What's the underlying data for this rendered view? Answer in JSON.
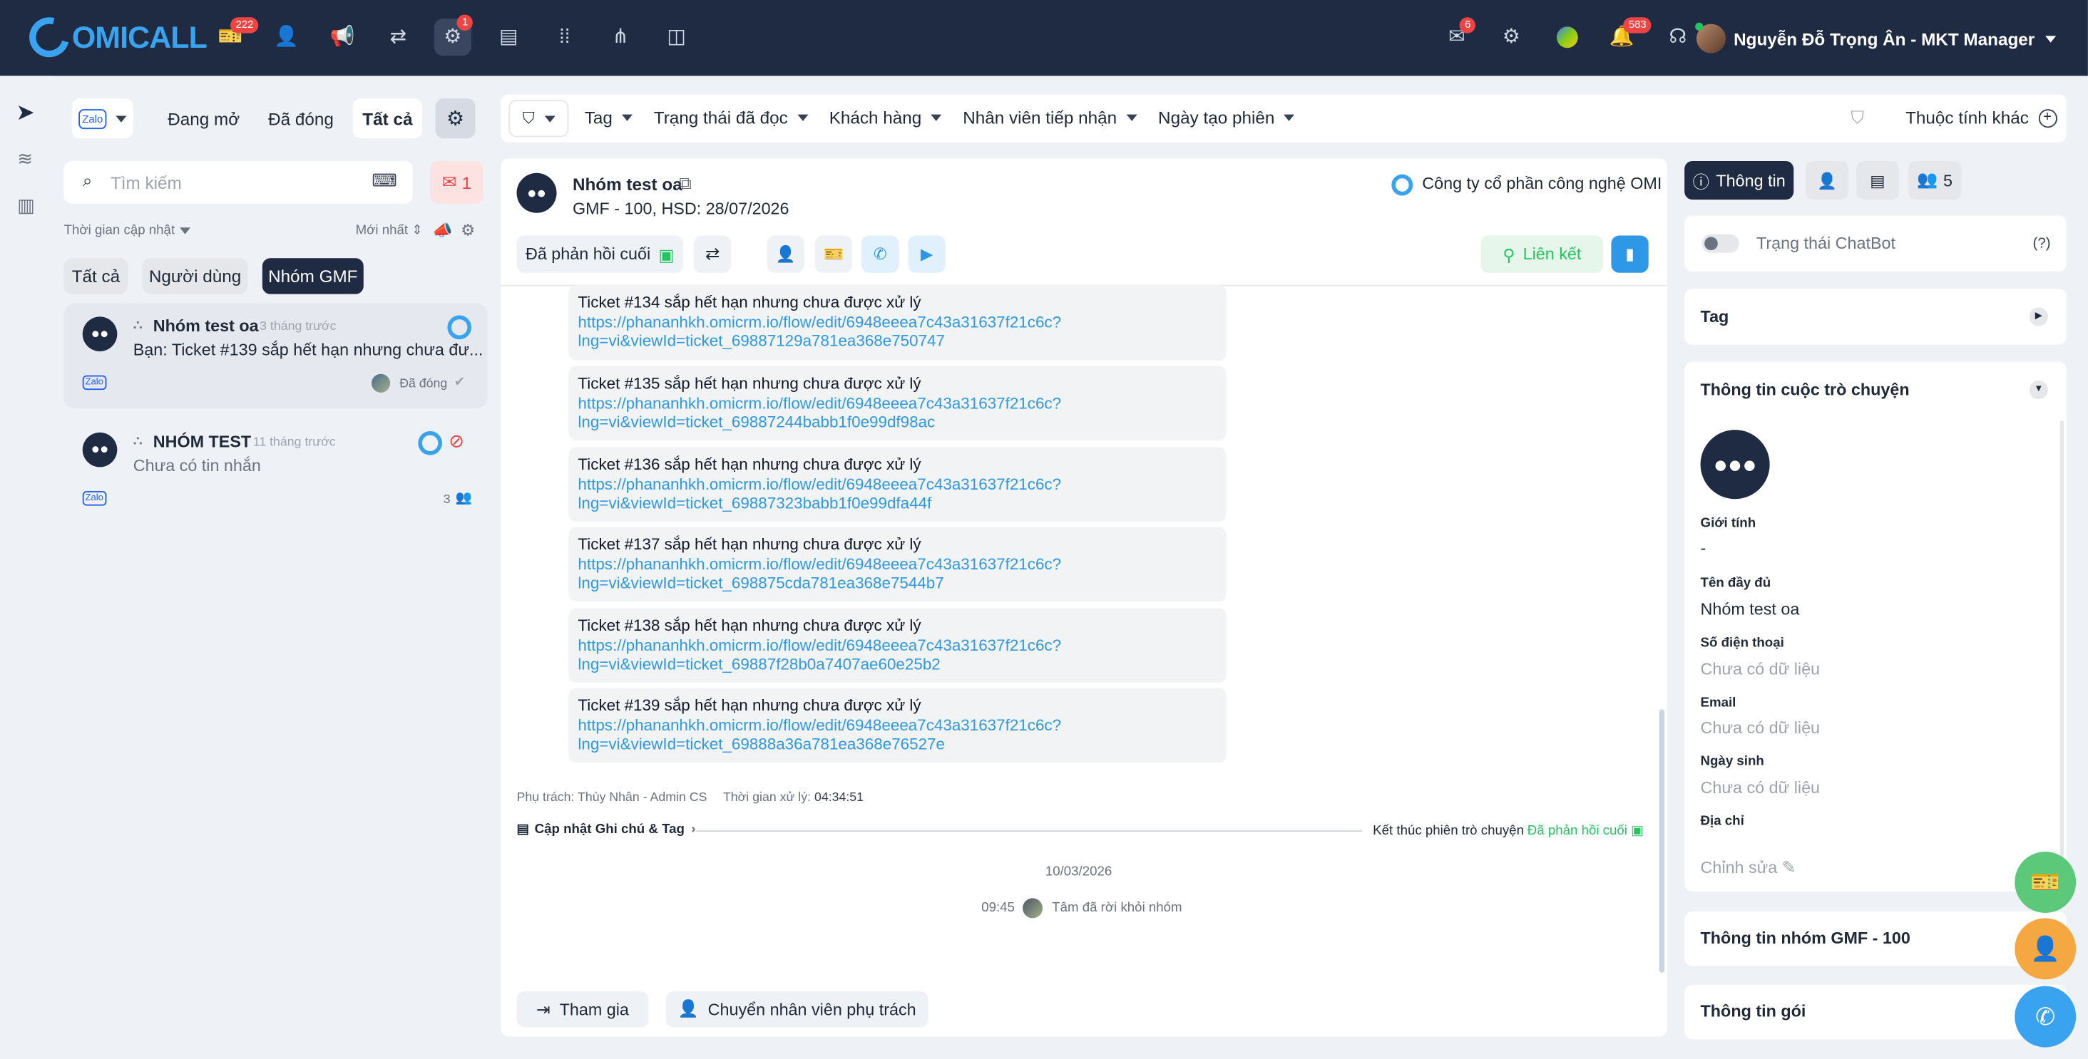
{
  "brand": {
    "logo": "OMICALL"
  },
  "nav": {
    "badges": [
      "222",
      "1"
    ]
  },
  "header_right": {
    "badges": [
      "6",
      "583"
    ],
    "user": "Nguyễn Đỗ Trọng Ân - MKT Manager"
  },
  "sidebar": {
    "tabs": [
      "Đang mở",
      "Đã đóng",
      "Tất cả"
    ],
    "unread_count": "1",
    "search_placeholder": "Tìm kiếm",
    "sort_label": "Thời gian cập nhật",
    "sort_order": "Mới nhất",
    "groups": [
      "Tất cả",
      "Người dùng",
      "Nhóm GMF"
    ],
    "conversations": [
      {
        "name": "Nhóm test oa",
        "time": "3 tháng trước",
        "preview": "Bạn: Ticket #139 sắp hết hạn nhưng chưa đư...",
        "status": "Đã đóng"
      },
      {
        "name": "NHÓM TEST",
        "time": "11 tháng trước",
        "preview": "Chưa có tin nhắn",
        "members": "3"
      }
    ]
  },
  "filters": {
    "items": [
      "Tag",
      "Trạng thái đã đọc",
      "Khách hàng",
      "Nhân viên tiếp nhận",
      "Ngày tạo phiên"
    ],
    "more": "Thuộc tính khác"
  },
  "chat": {
    "title": "Nhóm test oa",
    "subtitle": "GMF - 100, HSD: 28/07/2026",
    "company": "Công ty cổ phần công nghệ OMI",
    "replied": "Đã phản hồi cuối",
    "link_btn": "Liên kết",
    "messages": [
      {
        "text": "Ticket #134 sắp hết hạn nhưng chưa được xử lý",
        "link1": "https://phananhkh.omicrm.io/flow/edit/6948eeea7c43a31637f21c6c?",
        "link2": "lng=vi&viewId=ticket_69887129a781ea368e750747"
      },
      {
        "text": "Ticket #135 sắp hết hạn nhưng chưa được xử lý",
        "link1": "https://phananhkh.omicrm.io/flow/edit/6948eeea7c43a31637f21c6c?",
        "link2": "lng=vi&viewId=ticket_69887244babb1f0e99df98ac"
      },
      {
        "text": "Ticket #136 sắp hết hạn nhưng chưa được xử lý",
        "link1": "https://phananhkh.omicrm.io/flow/edit/6948eeea7c43a31637f21c6c?",
        "link2": "lng=vi&viewId=ticket_69887323babb1f0e99dfa44f"
      },
      {
        "text": "Ticket #137 sắp hết hạn nhưng chưa được xử lý",
        "link1": "https://phananhkh.omicrm.io/flow/edit/6948eeea7c43a31637f21c6c?",
        "link2": "lng=vi&viewId=ticket_698875cda781ea368e7544b7"
      },
      {
        "text": "Ticket #138 sắp hết hạn nhưng chưa được xử lý",
        "link1": "https://phananhkh.omicrm.io/flow/edit/6948eeea7c43a31637f21c6c?",
        "link2": "lng=vi&viewId=ticket_69887f28b0a7407ae60e25b2"
      },
      {
        "text": "Ticket #139 sắp hết hạn nhưng chưa được xử lý",
        "link1": "https://phananhkh.omicrm.io/flow/edit/6948eeea7c43a31637f21c6c?",
        "link2": "lng=vi&viewId=ticket_69888a36a781ea368e76527e"
      }
    ],
    "assignee_label": "Phụ trách:",
    "assignee": "Thùy Nhân - Admin CS",
    "handle_label": "Thời gian xử lý:",
    "handle_time": "04:34:51",
    "update_note": "Cập nhật Ghi chú & Tag",
    "session_end": "Kết thúc phiên trò chuyện",
    "session_end_status": "Đã phản hồi cuối",
    "date": "10/03/2026",
    "event_time": "09:45",
    "event_text": "Tâm đã rời khỏi nhóm",
    "join_btn": "Tham gia",
    "transfer_btn": "Chuyển nhân viên phụ trách"
  },
  "right": {
    "tab_info": "Thông tin",
    "members_count": "5",
    "chatbot": "Trạng thái ChatBot",
    "help": "(?)",
    "tag": "Tag",
    "conv_info": "Thông tin cuộc trò chuyện",
    "fields": [
      {
        "label": "Giới tính",
        "value": "-"
      },
      {
        "label": "Tên đầy đủ",
        "value": "Nhóm test oa"
      },
      {
        "label": "Số điện thoại",
        "value": "Chưa có dữ liệu"
      },
      {
        "label": "Email",
        "value": "Chưa có dữ liệu"
      },
      {
        "label": "Ngày sinh",
        "value": "Chưa có dữ liệu"
      },
      {
        "label": "Địa chỉ",
        "value": ""
      }
    ],
    "edit": "Chỉnh sửa",
    "group_info": "Thông tin nhóm GMF - 100",
    "package_info": "Thông tin gói"
  }
}
